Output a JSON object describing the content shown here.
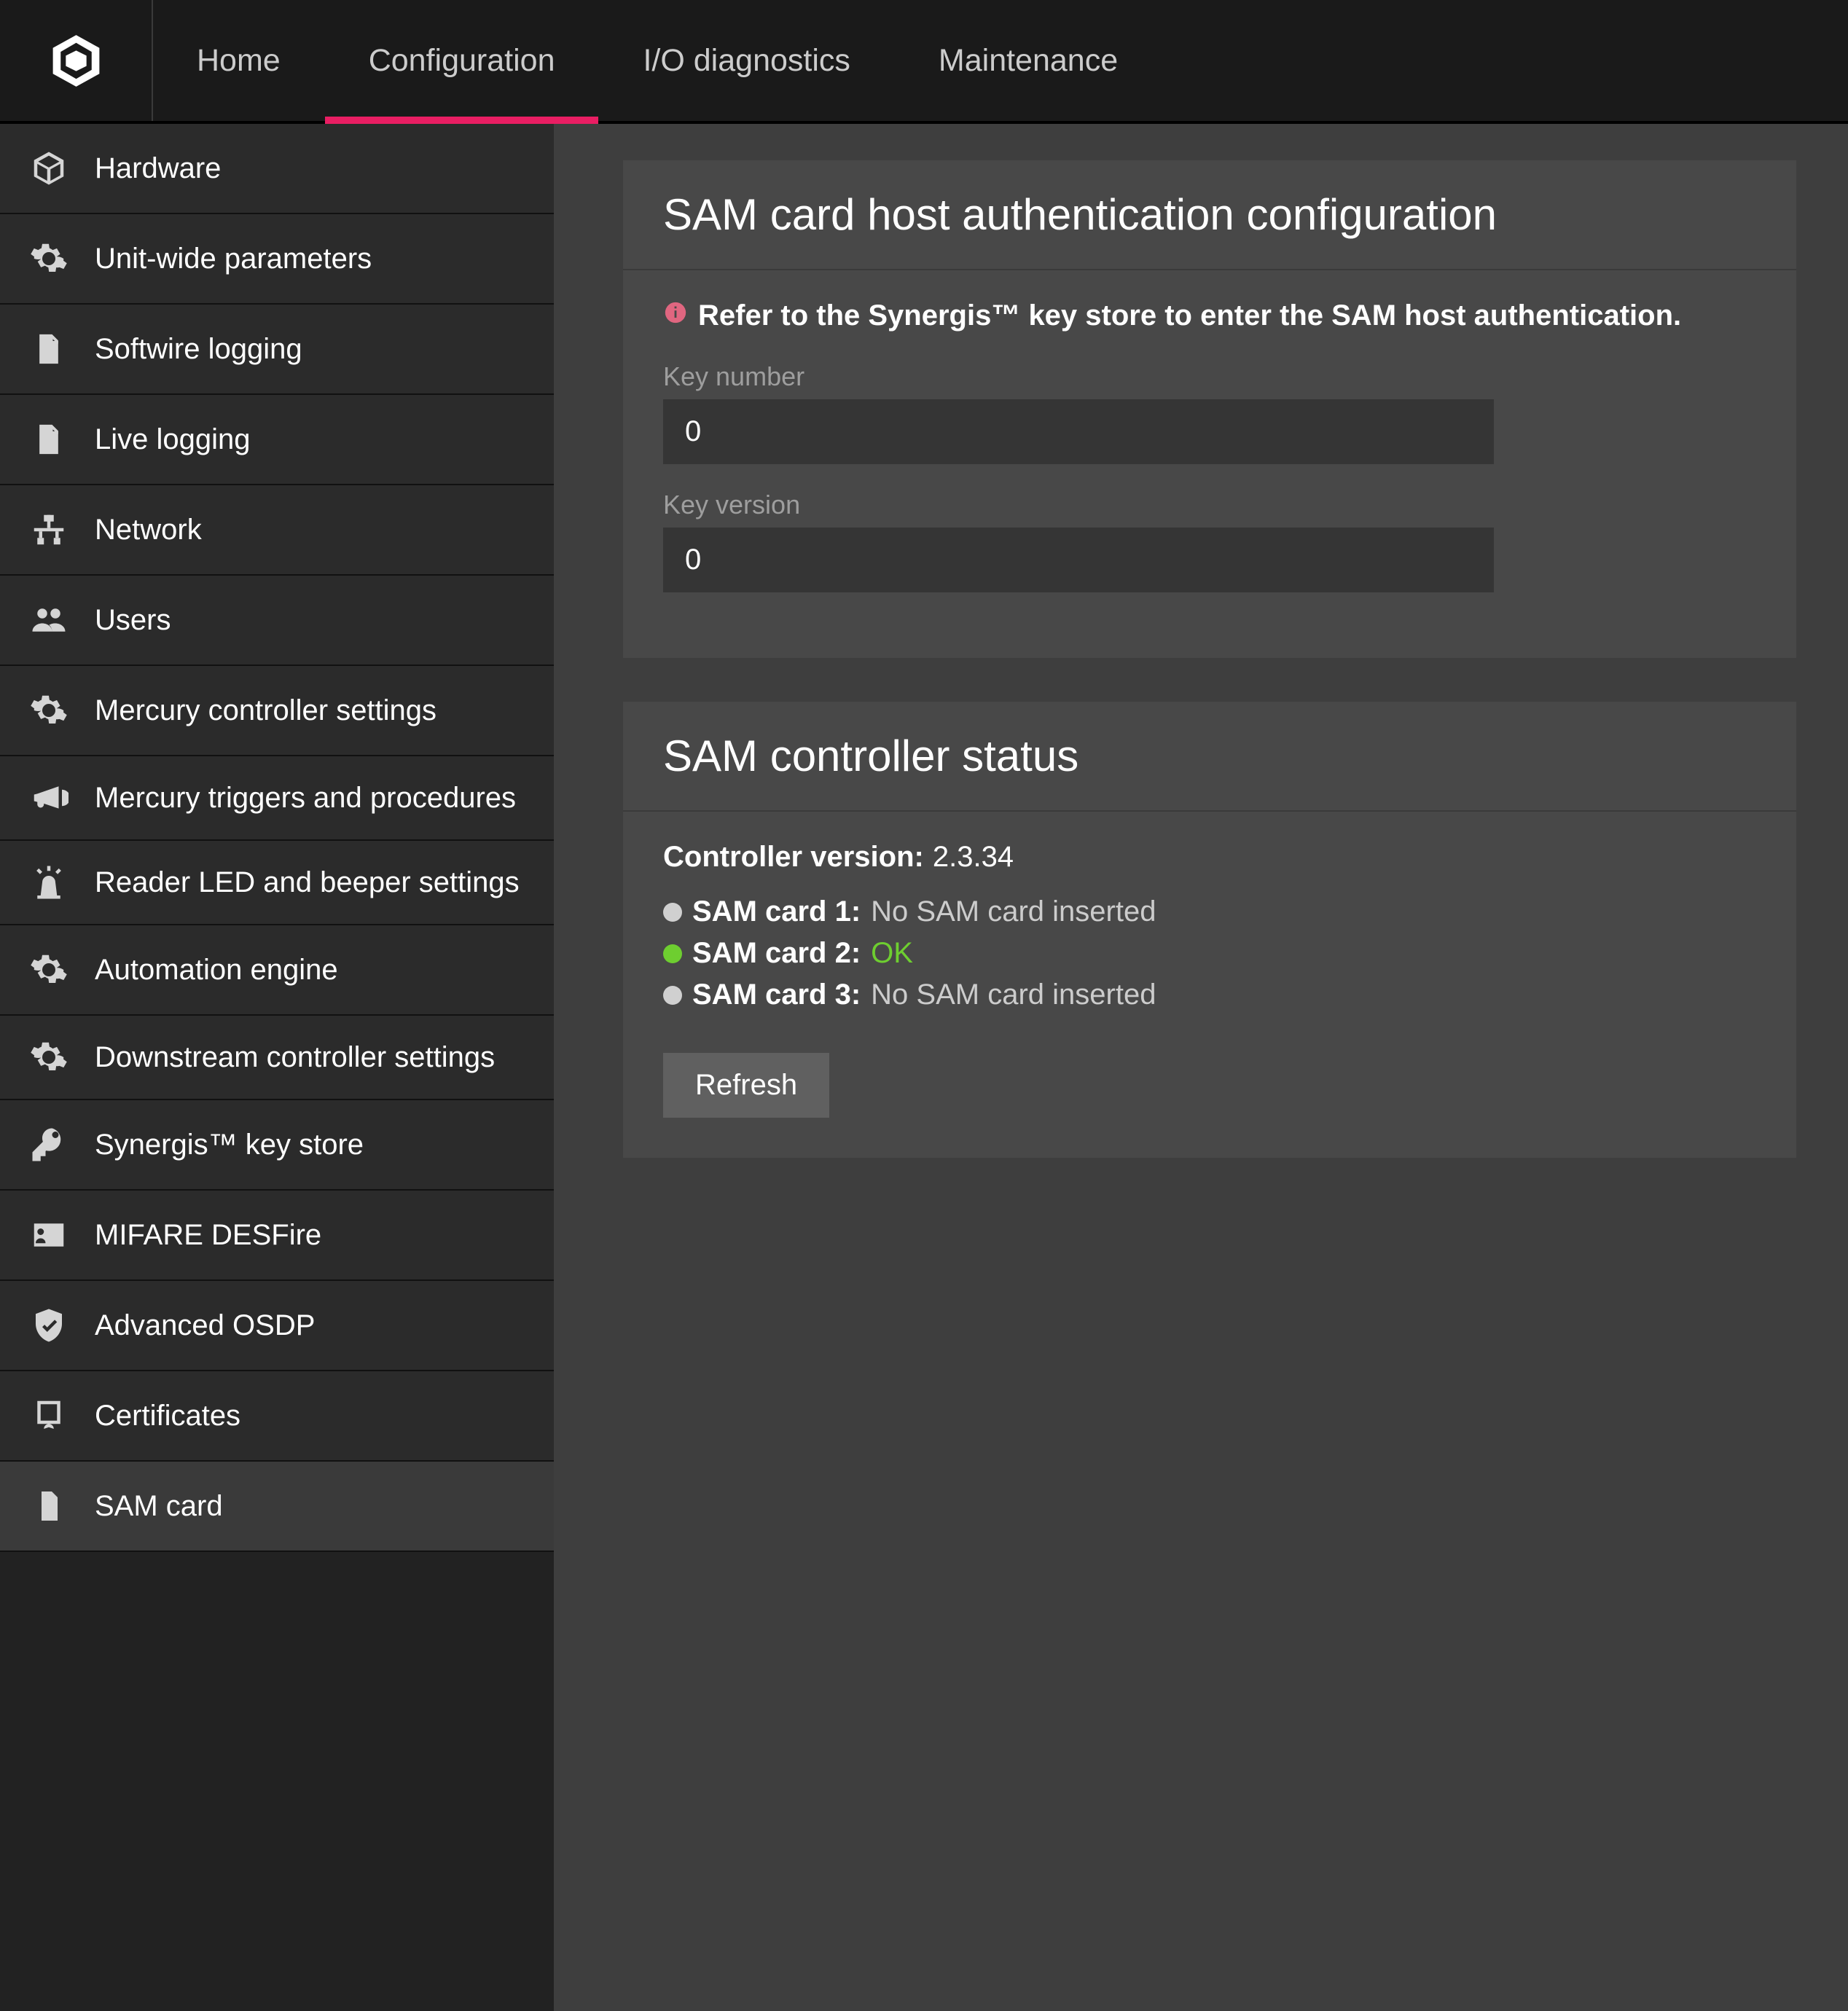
{
  "topnav": {
    "tabs": [
      {
        "label": "Home"
      },
      {
        "label": "Configuration",
        "active": true
      },
      {
        "label": "I/O diagnostics"
      },
      {
        "label": "Maintenance"
      }
    ]
  },
  "sidebar": {
    "items": [
      {
        "icon": "cube-icon",
        "label": "Hardware"
      },
      {
        "icon": "gear-icon",
        "label": "Unit-wide parameters"
      },
      {
        "icon": "file-icon",
        "label": "Softwire logging"
      },
      {
        "icon": "file-icon",
        "label": "Live logging"
      },
      {
        "icon": "network-icon",
        "label": "Network"
      },
      {
        "icon": "users-icon",
        "label": "Users"
      },
      {
        "icon": "gear-icon",
        "label": "Mercury controller settings"
      },
      {
        "icon": "megaphone-icon",
        "label": "Mercury triggers and procedures"
      },
      {
        "icon": "siren-icon",
        "label": "Reader LED and beeper settings"
      },
      {
        "icon": "gear-icon",
        "label": "Automation engine"
      },
      {
        "icon": "gear-icon",
        "label": "Downstream controller settings"
      },
      {
        "icon": "key-icon",
        "label": "Synergis™ key store"
      },
      {
        "icon": "idcard-icon",
        "label": "MIFARE DESFire"
      },
      {
        "icon": "shield-check-icon",
        "label": "Advanced OSDP"
      },
      {
        "icon": "certificate-icon",
        "label": "Certificates"
      },
      {
        "icon": "sim-icon",
        "label": "SAM card",
        "active": true
      }
    ]
  },
  "sam_auth": {
    "title": "SAM card host authentication configuration",
    "notice": "Refer to the Synergis™ key store to enter the SAM host authentication.",
    "key_number_label": "Key number",
    "key_number_value": "0",
    "key_version_label": "Key version",
    "key_version_value": "0"
  },
  "sam_status": {
    "title": "SAM controller status",
    "controller_version_label": "Controller version:",
    "controller_version_value": "2.3.34",
    "cards": [
      {
        "label": "SAM card 1:",
        "status": "No SAM card inserted",
        "ok": false
      },
      {
        "label": "SAM card 2:",
        "status": "OK",
        "ok": true
      },
      {
        "label": "SAM card 3:",
        "status": "No SAM card inserted",
        "ok": false
      }
    ],
    "refresh_label": "Refresh"
  }
}
